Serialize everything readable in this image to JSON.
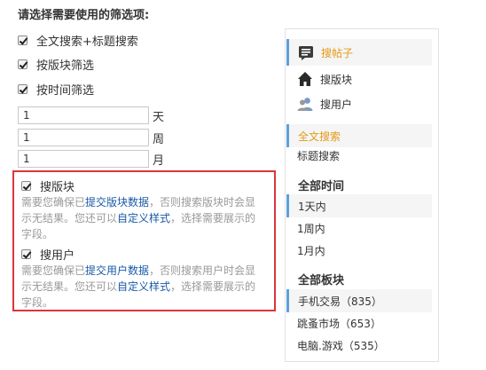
{
  "heading": "请选择需要使用的筛选项:",
  "options": [
    {
      "label": "全文搜索+标题搜索",
      "checked": true
    },
    {
      "label": "按版块筛选",
      "checked": true
    },
    {
      "label": "按时间筛选",
      "checked": true
    }
  ],
  "time_inputs": [
    {
      "value": "1",
      "unit": "天"
    },
    {
      "value": "1",
      "unit": "周"
    },
    {
      "value": "1",
      "unit": "月"
    }
  ],
  "blocks": [
    {
      "title": "搜版块",
      "checked": true,
      "desc_before": "需要您确保已",
      "link1": "提交版块数据",
      "desc_mid": "，否则搜索版块时会显示无结果。您还可以",
      "link2": "自定义样式",
      "desc_after": "，选择需要展示的字段。"
    },
    {
      "title": "搜用户",
      "checked": true,
      "desc_before": "需要您确保已",
      "link1": "提交用户数据",
      "desc_mid": "，否则搜索用户时会显示无结果。您还可以",
      "link2": "自定义样式",
      "desc_after": "，选择需要展示的字段。"
    }
  ],
  "sidebar": {
    "nav": [
      {
        "label": "搜帖子",
        "icon": "post-icon"
      },
      {
        "label": "搜版块",
        "icon": "home-icon"
      },
      {
        "label": "搜用户",
        "icon": "users-icon"
      }
    ],
    "search_types": [
      "全文搜索",
      "标题搜索"
    ],
    "time_heading": "全部时间",
    "time_options": [
      "1天内",
      "1周内",
      "1月内"
    ],
    "board_heading": "全部板块",
    "boards": [
      "手机交易（835）",
      "跳蚤市场（653）",
      "电脑.游戏（535）"
    ]
  },
  "colors": {
    "accent": "#e39a14",
    "link": "#1a5aa6",
    "highlight_box": "#d9363e",
    "sidebar_marker": "#5da0dc"
  }
}
